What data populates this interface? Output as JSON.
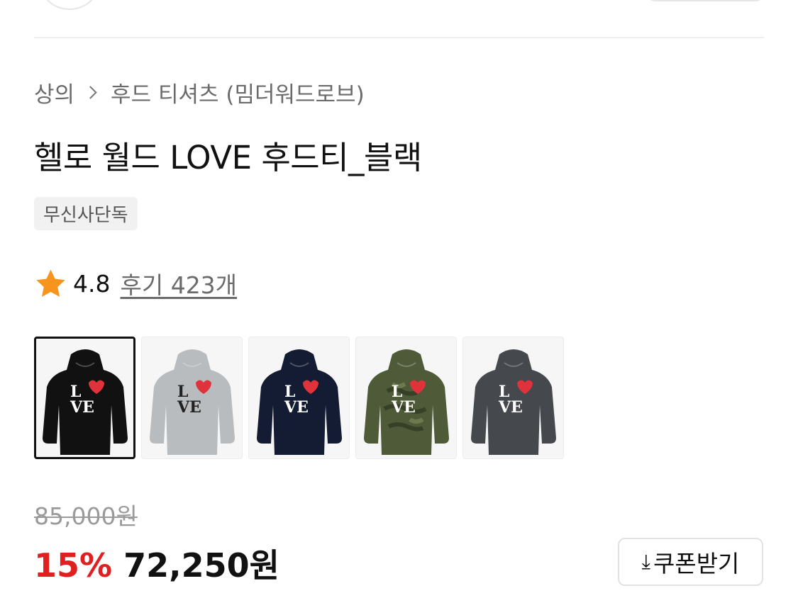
{
  "breadcrumb": {
    "category": "상의",
    "subcategory": "후드 티셔츠 (밈더워드로브)"
  },
  "product": {
    "title": "헬로 월드 LOVE 후드티_블랙",
    "badge": "무신사단독"
  },
  "rating": {
    "score": "4.8",
    "reviews_label": "후기 423개",
    "star_color": "#f7941d"
  },
  "thumbnails": [
    {
      "name": "black",
      "body_color": "#111111",
      "letter_color": "#ffffff",
      "selected": true
    },
    {
      "name": "gray",
      "body_color": "#b8bcbf",
      "letter_color": "#222222",
      "selected": false
    },
    {
      "name": "navy",
      "body_color": "#141c33",
      "letter_color": "#ffffff",
      "selected": false
    },
    {
      "name": "camo",
      "body_color": "#4f5a38",
      "letter_color": "#ffffff",
      "selected": false
    },
    {
      "name": "charcoal",
      "body_color": "#45484d",
      "letter_color": "#ffffff",
      "selected": false
    }
  ],
  "price": {
    "original": "85,000원",
    "discount": "15%",
    "final": "72,250원",
    "discount_color": "#e02020"
  },
  "coupon": {
    "icon": "download-icon",
    "label": "쿠폰받기"
  }
}
